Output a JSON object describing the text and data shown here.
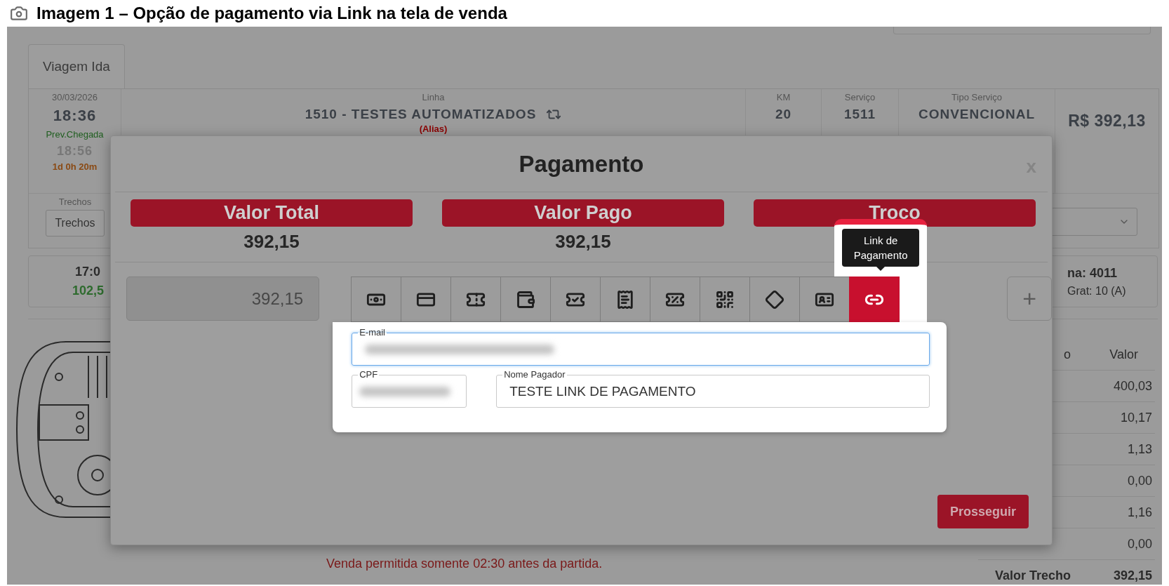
{
  "caption": {
    "text": "Imagem 1 – Opção de pagamento via Link na tela de venda"
  },
  "trip_tabs": [
    {
      "label": "Viagem Ida",
      "selected": true
    }
  ],
  "trip": {
    "date": "30/03/2026",
    "departure": "18:36",
    "arrival_label": "Prev.Chegada",
    "arrival": "18:56",
    "duration": "1d 0h 20m",
    "segments_label": "Trechos",
    "segments_button": "Trechos",
    "columns": [
      {
        "header": "Linha",
        "value": "1510 - TESTES AUTOMATIZADOS",
        "note": "(Alias)"
      },
      {
        "header": "KM",
        "value": "20"
      },
      {
        "header": "Serviço",
        "value": "1511"
      },
      {
        "header": "Tipo Serviço",
        "value": "CONVENCIONAL"
      }
    ],
    "price": "R$ 392,13"
  },
  "schedule_card": {
    "time": "17:0",
    "amount": "102,5"
  },
  "seat_card": {
    "line_1": "na: 4011",
    "line_2": "Grat: 10 (A)"
  },
  "fare_table": {
    "columns": [
      "o",
      "Valor"
    ],
    "rows": [
      "400,03",
      "10,17",
      "1,13",
      "0,00",
      "1,16",
      "0,00"
    ],
    "total_label": "Valor Trecho",
    "total": "392,15"
  },
  "notice": "Venda permitida somente 02:30 antes da partida.",
  "modal": {
    "title": "Pagamento",
    "close": "x",
    "summary": [
      {
        "label": "Valor Total",
        "value": "392,15"
      },
      {
        "label": "Valor Pago",
        "value": "392,15"
      },
      {
        "label": "Troco"
      }
    ],
    "amount_field": "392,15",
    "methods": [
      {
        "kind": "cash",
        "selected": false
      },
      {
        "kind": "card",
        "selected": false
      },
      {
        "kind": "voucher",
        "selected": false
      },
      {
        "kind": "dollar-card",
        "selected": false
      },
      {
        "kind": "ticket",
        "selected": false
      },
      {
        "kind": "receipt",
        "selected": false
      },
      {
        "kind": "discount",
        "selected": false
      },
      {
        "kind": "qr",
        "selected": false
      },
      {
        "kind": "pix",
        "selected": false
      },
      {
        "kind": "document",
        "selected": false
      },
      {
        "kind": "link",
        "selected": true,
        "tooltip": "Link de Pagamento"
      }
    ],
    "add_button": "+",
    "form": {
      "email": {
        "label": "E-mail",
        "focused": true
      },
      "cpf": {
        "label": "CPF"
      },
      "payer": {
        "label": "Nome Pagador",
        "value": "TESTE LINK DE PAGAMENTO"
      }
    },
    "proceed_button": "Prosseguir"
  }
}
